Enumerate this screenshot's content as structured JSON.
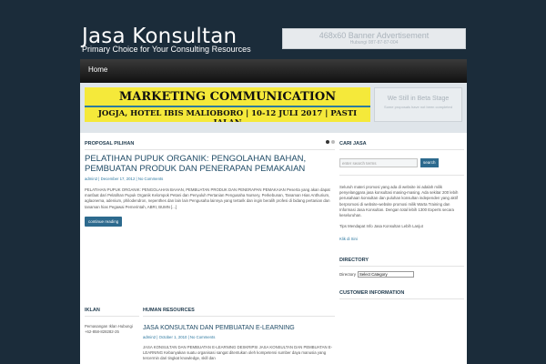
{
  "header": {
    "site_title": "Jasa Konsultan",
    "site_description": "Primary Choice for Your Consulting Resources",
    "banner_ad_title": "468x60 Banner Advertisement",
    "banner_ad_sub": "Hubungi 087-87-87-004"
  },
  "nav": {
    "items": [
      {
        "label": "Home"
      }
    ]
  },
  "banner": {
    "line1": "MARKETING COMMUNICATION",
    "line2": "JOGJA, HOTEL IBIS MALIOBORO | 10-12 JULI 2017 | PASTI JALAN",
    "beta_title": "We Still in Beta Stage",
    "beta_sub": "Some proposals have not been completed"
  },
  "featured": {
    "heading": "PROPOSAL PILIHAN",
    "post": {
      "title": "PELATIHAN PUPUK ORGANIK: PENGOLAHAN BAHAN, PEMBUATAN PRODUK DAN PENERAPAN PEMAKAIAN",
      "meta": "admin2 | December 17, 2012 | No Comments",
      "excerpt": "PELATIHAN PUPUK ORGANIK: PENGOLAHAN BAHAN, PEMBUATAN PRODUK DAN PENERAPAN PEMAKAIAN Peserta yang akan dapat manfaat dari Pelatihan Pupuk Organik Kelompok Petani dan Penyuluh Pertanian Pengusaha Nursery, Perkebunan, Tanaman Hias Anthurium, aglaonema, adenium, philodendron, nepenthes dan lain lain Pengusaha lainnya yang tertarik dan ingin beralih profesi di bidang pertanian dan tanaman hias Pegawai Pemerintah, ABRI, BUMN [...]",
      "button": "continue reading"
    }
  },
  "iklan": {
    "heading": "IKLAN",
    "text": "Pemasangan Iklan Hubungi +62-858-828282-25"
  },
  "human_resources": {
    "heading": "HUMAN RESOURCES",
    "post": {
      "title": "JASA KONSULTAN DAN PEMBUATAN E-LEARNING",
      "meta": "admin2 | October 1, 2010 | No Comments",
      "excerpt": "JASA KONSULTAN DAN PEMBUATAN E-LEARNING DESKRIPSI JASA KONSULTAN DAN PEMBUATAN E-LEARNING Kebanyakan suatu organisasi sangat ditentukan oleh kompetensi sumber daya manusia yang tercermin dari tingkat knowledge, skill dan"
    }
  },
  "sidebar": {
    "search_heading": "CARI JASA",
    "search_placeholder": "enter search terms",
    "search_button": "search",
    "about_text": "Seluruh materi promosi yang ada di website ini adalah milik penyelanggara jasa konsultasi masing-masing. Ada sekitar 200 lebih perusahaan konsultan dan puluhan konsultan independen yang aktif berpromosi di website-website promosi milik Warta Training dan Informasi Jasa Konsultan. Dengan total lebih 1300 Experts secara keseluruhan.",
    "tips_text": "Tips Mendapat Info Jasa Konsultan Lebih Lanjut",
    "tips_link": "Klik di Sini",
    "directory_heading": "DIRECTORY",
    "directory_label": "Directory",
    "directory_select": "Select Category",
    "customer_heading": "CUSTOMER INFORMATION"
  }
}
